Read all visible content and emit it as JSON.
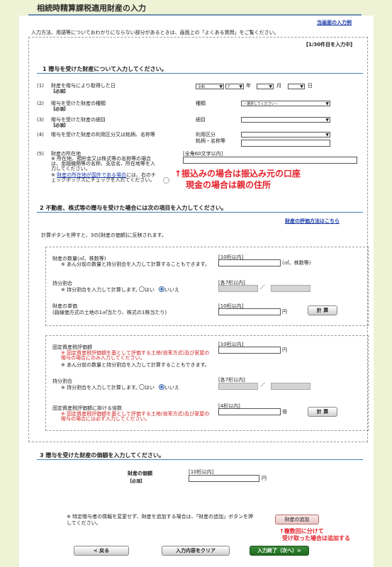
{
  "title": "相続時精算課税適用財産の入力",
  "example_link": "当画面の入力例",
  "help_text": "入力方法、用語等についておわかりにならない部分があるときは、画面上の「よくある質問」をご覧ください。",
  "progress": "【1/30件目を入力中】",
  "section1": {
    "heading": "1 贈与を受けた財産について入力してください。",
    "rows": [
      {
        "num": "(1)",
        "label": "財産を贈与により取得した日",
        "req": "【必須】"
      },
      {
        "num": "(2)",
        "label": "贈与を受けた財産の種類",
        "req": "【必須】",
        "field_label": "種類",
        "select_value": "－選択してください－"
      },
      {
        "num": "(3)",
        "label": "贈与を受けた財産の細目",
        "req": "【必須】",
        "field_label": "細目"
      },
      {
        "num": "(4)",
        "label": "贈与を受けた財産の利用区分又は銘柄、名称等",
        "field_label": "利用区分\n銘柄・名称等"
      },
      {
        "num": "(5)",
        "label": "財産の所在地",
        "note1": "※ 所在地、預貯金又は株式等の名称等の場合は、金融機関等の名称、支店名、所在地等を入力してください。",
        "note2_link": "財産の所在地が国外である場合",
        "note2": "には、右のチェックボックスにチェックを入れてください。",
        "hint": "[全角60文字以内]"
      }
    ],
    "date": {
      "era": "令和",
      "era_year": "7",
      "year_label": "年",
      "month_label": "月",
      "day_label": "日"
    }
  },
  "annotation1_line1": "↑振込みの場合は振込み元の口座",
  "annotation1_line2": "現金の場合は親の住所",
  "section2": {
    "heading": "2 不動産、株式等の贈与を受けた場合には次の項目を入力してください。",
    "eval_link": "財産の評価方法はこちら",
    "calc_note": "計算ボタンを押すと、3の[財産の価額]に反映されます。",
    "quantity_label": "財産の数量(㎡、株数等)",
    "quantity_note": "※ あん分前の数量と持分割合を入力して計算することもできます。",
    "quantity_hint": "[10桁以内]",
    "quantity_unit": "(㎡、株数等)",
    "share_label": "持分割合",
    "share_note": "※ 持分割合を入力して計算します。",
    "share_hint": "[各7桁以内]",
    "yes_label": "はい",
    "no_label": "いいえ",
    "unit_price_label": "財産の単価",
    "unit_price_sub": "(路線価方式の土地の1㎡当たり、株式の1株当たり)",
    "unit_price_hint": "[10桁以内]",
    "yen": "円",
    "calc_btn": "計 算",
    "fixed_label": "固定資産税評価額",
    "fixed_note_red": "※ 固定資産税評価額を基として評価する土地(倍率方式)及び家屋の贈与の場合にのみ入力してください。",
    "fixed_note2": "※ あん分前の数量と持分割合を入力して計算することもできます。",
    "fixed_hint": "[10桁以内]",
    "multiplier_label": "固定資産税評価額に掛ける倍数",
    "multiplier_note_red": "※ 固定資産税評価額を基として評価する土地(倍率方式)及び家屋の贈与の場合には必ず入力してください。",
    "multiplier_hint": "[4桁以内]",
    "multiplier_unit": "倍"
  },
  "section3": {
    "heading": "3 贈与を受けた財産の価額を入力してください。",
    "value_label": "財産の価額",
    "req": "【必須】",
    "hint": "[10桁以内]",
    "yen": "円"
  },
  "footer_note": "※ 特定贈与者の情報を変更せず、財産を追加する場合は、「財産の追加」ボタンを押してください。",
  "add_btn": "財産の追加",
  "annotation2_line1": "↑複数回に分けて",
  "annotation2_line2": "受け取った場合は追加する",
  "back_btn": "< 戻る",
  "clear_btn": "入力内容をクリア",
  "next_btn": "入力終了（次へ）>"
}
